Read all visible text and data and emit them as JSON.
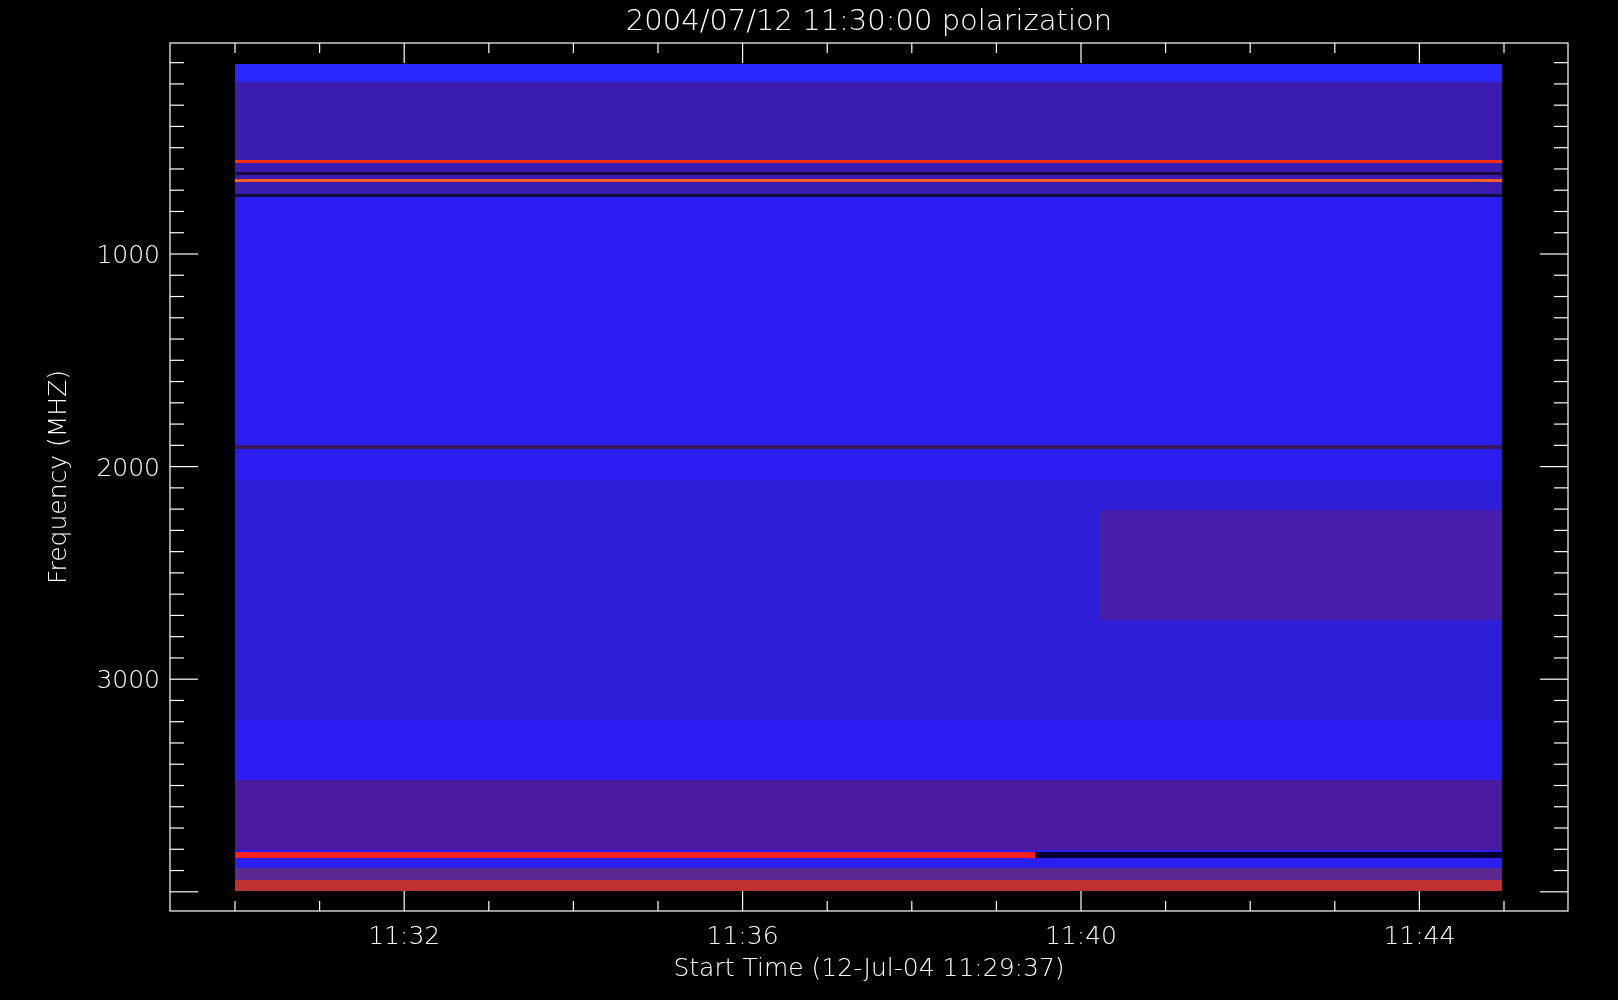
{
  "title": "2004/07/12 11:30:00 polarization",
  "x_axis": {
    "label": "Start Time (12-Jul-04 11:29:37)",
    "ticks": [
      "11:32",
      "11:36",
      "11:40",
      "11:44"
    ]
  },
  "y_axis": {
    "label": "Frequency (MHZ)",
    "ticks": [
      "1000",
      "2000",
      "3000"
    ]
  }
}
